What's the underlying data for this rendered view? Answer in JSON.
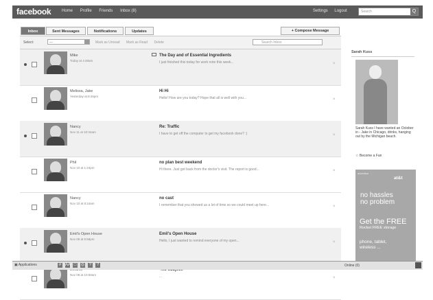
{
  "topbar": {
    "logo": "facebook",
    "nav": [
      "Home",
      "Profile",
      "Friends",
      "Inbox (8)"
    ],
    "right": [
      "Settings",
      "Logout"
    ],
    "search_placeholder": "Search",
    "search_btn": "Q"
  },
  "tabs": [
    {
      "label": "Inbox"
    },
    {
      "label": "Sent Messages"
    },
    {
      "label": "Notifications"
    },
    {
      "label": "Updates"
    }
  ],
  "compose": "+ Compose Message",
  "toolbar": {
    "select_label": "Select:",
    "select_value": "---",
    "links": [
      "Mark as Unread",
      "Mark as Read",
      "Delete"
    ],
    "search_placeholder": "Search Inbox"
  },
  "messages": [
    {
      "name": "Mike",
      "date": "Today at 4:48am",
      "subject": "The Day and of Essential Ingredients",
      "snippet": "I just finished this today for work note this week...",
      "unread": true,
      "attachment": true
    },
    {
      "name": "Melissa, Jake",
      "date": "Yesterday at 8:45pm",
      "subject": "Hi Hi",
      "snippet": "Hello! How are you today? Hope that all is well with you...",
      "unread": false,
      "attachment": false
    },
    {
      "name": "Nancy",
      "date": "Nov 11 at 10:34am",
      "subject": "Re: Traffic",
      "snippet": "I have to get off the computer to get my facebook done? :)",
      "unread": true,
      "attachment": false
    },
    {
      "name": "Phil",
      "date": "Nov 10 at 1:24pm",
      "subject": "no plan best weekend",
      "snippet": "Hi there. Just got back from the doctor's visit. The report is good...",
      "unread": false,
      "attachment": false
    },
    {
      "name": "Nancy",
      "date": "Nov 10 at 8:24am",
      "subject": "no cast",
      "snippet": "I remember that you showed us a lot of time so we could meet up here...",
      "unread": false,
      "attachment": false
    },
    {
      "name": "Emil's Open House",
      "date": "Nov 09 at 5:58pm",
      "subject": "Emil's Open House",
      "snippet": "Hello, I just wanted to remind everyone of my open...",
      "unread": true,
      "attachment": false
    },
    {
      "name": "Eleanor",
      "date": "Nov 08 at 10:58am",
      "subject": "<no subject>",
      "snippet": "...",
      "unread": false,
      "attachment": false
    }
  ],
  "sidebar": {
    "title": "Sarah Kuss",
    "text": "Sarah Kuss I have wanted an October in - Jake in Chicago, drinks, hanging out by the Michigan beach.",
    "fan": "Become a Fan"
  },
  "ad": {
    "top": "advertise",
    "logo": "at&t",
    "big": [
      "no hassles",
      "no problem"
    ],
    "get": [
      "Get the FREE",
      "Rocket FREE storage"
    ],
    "small": [
      "phone, tablet,",
      "wireless ..."
    ]
  },
  "bottombar": {
    "apps": "Applications",
    "icons": [
      "#",
      "AA",
      "□",
      "◎",
      "?",
      "?"
    ],
    "online": "Online (0)"
  }
}
